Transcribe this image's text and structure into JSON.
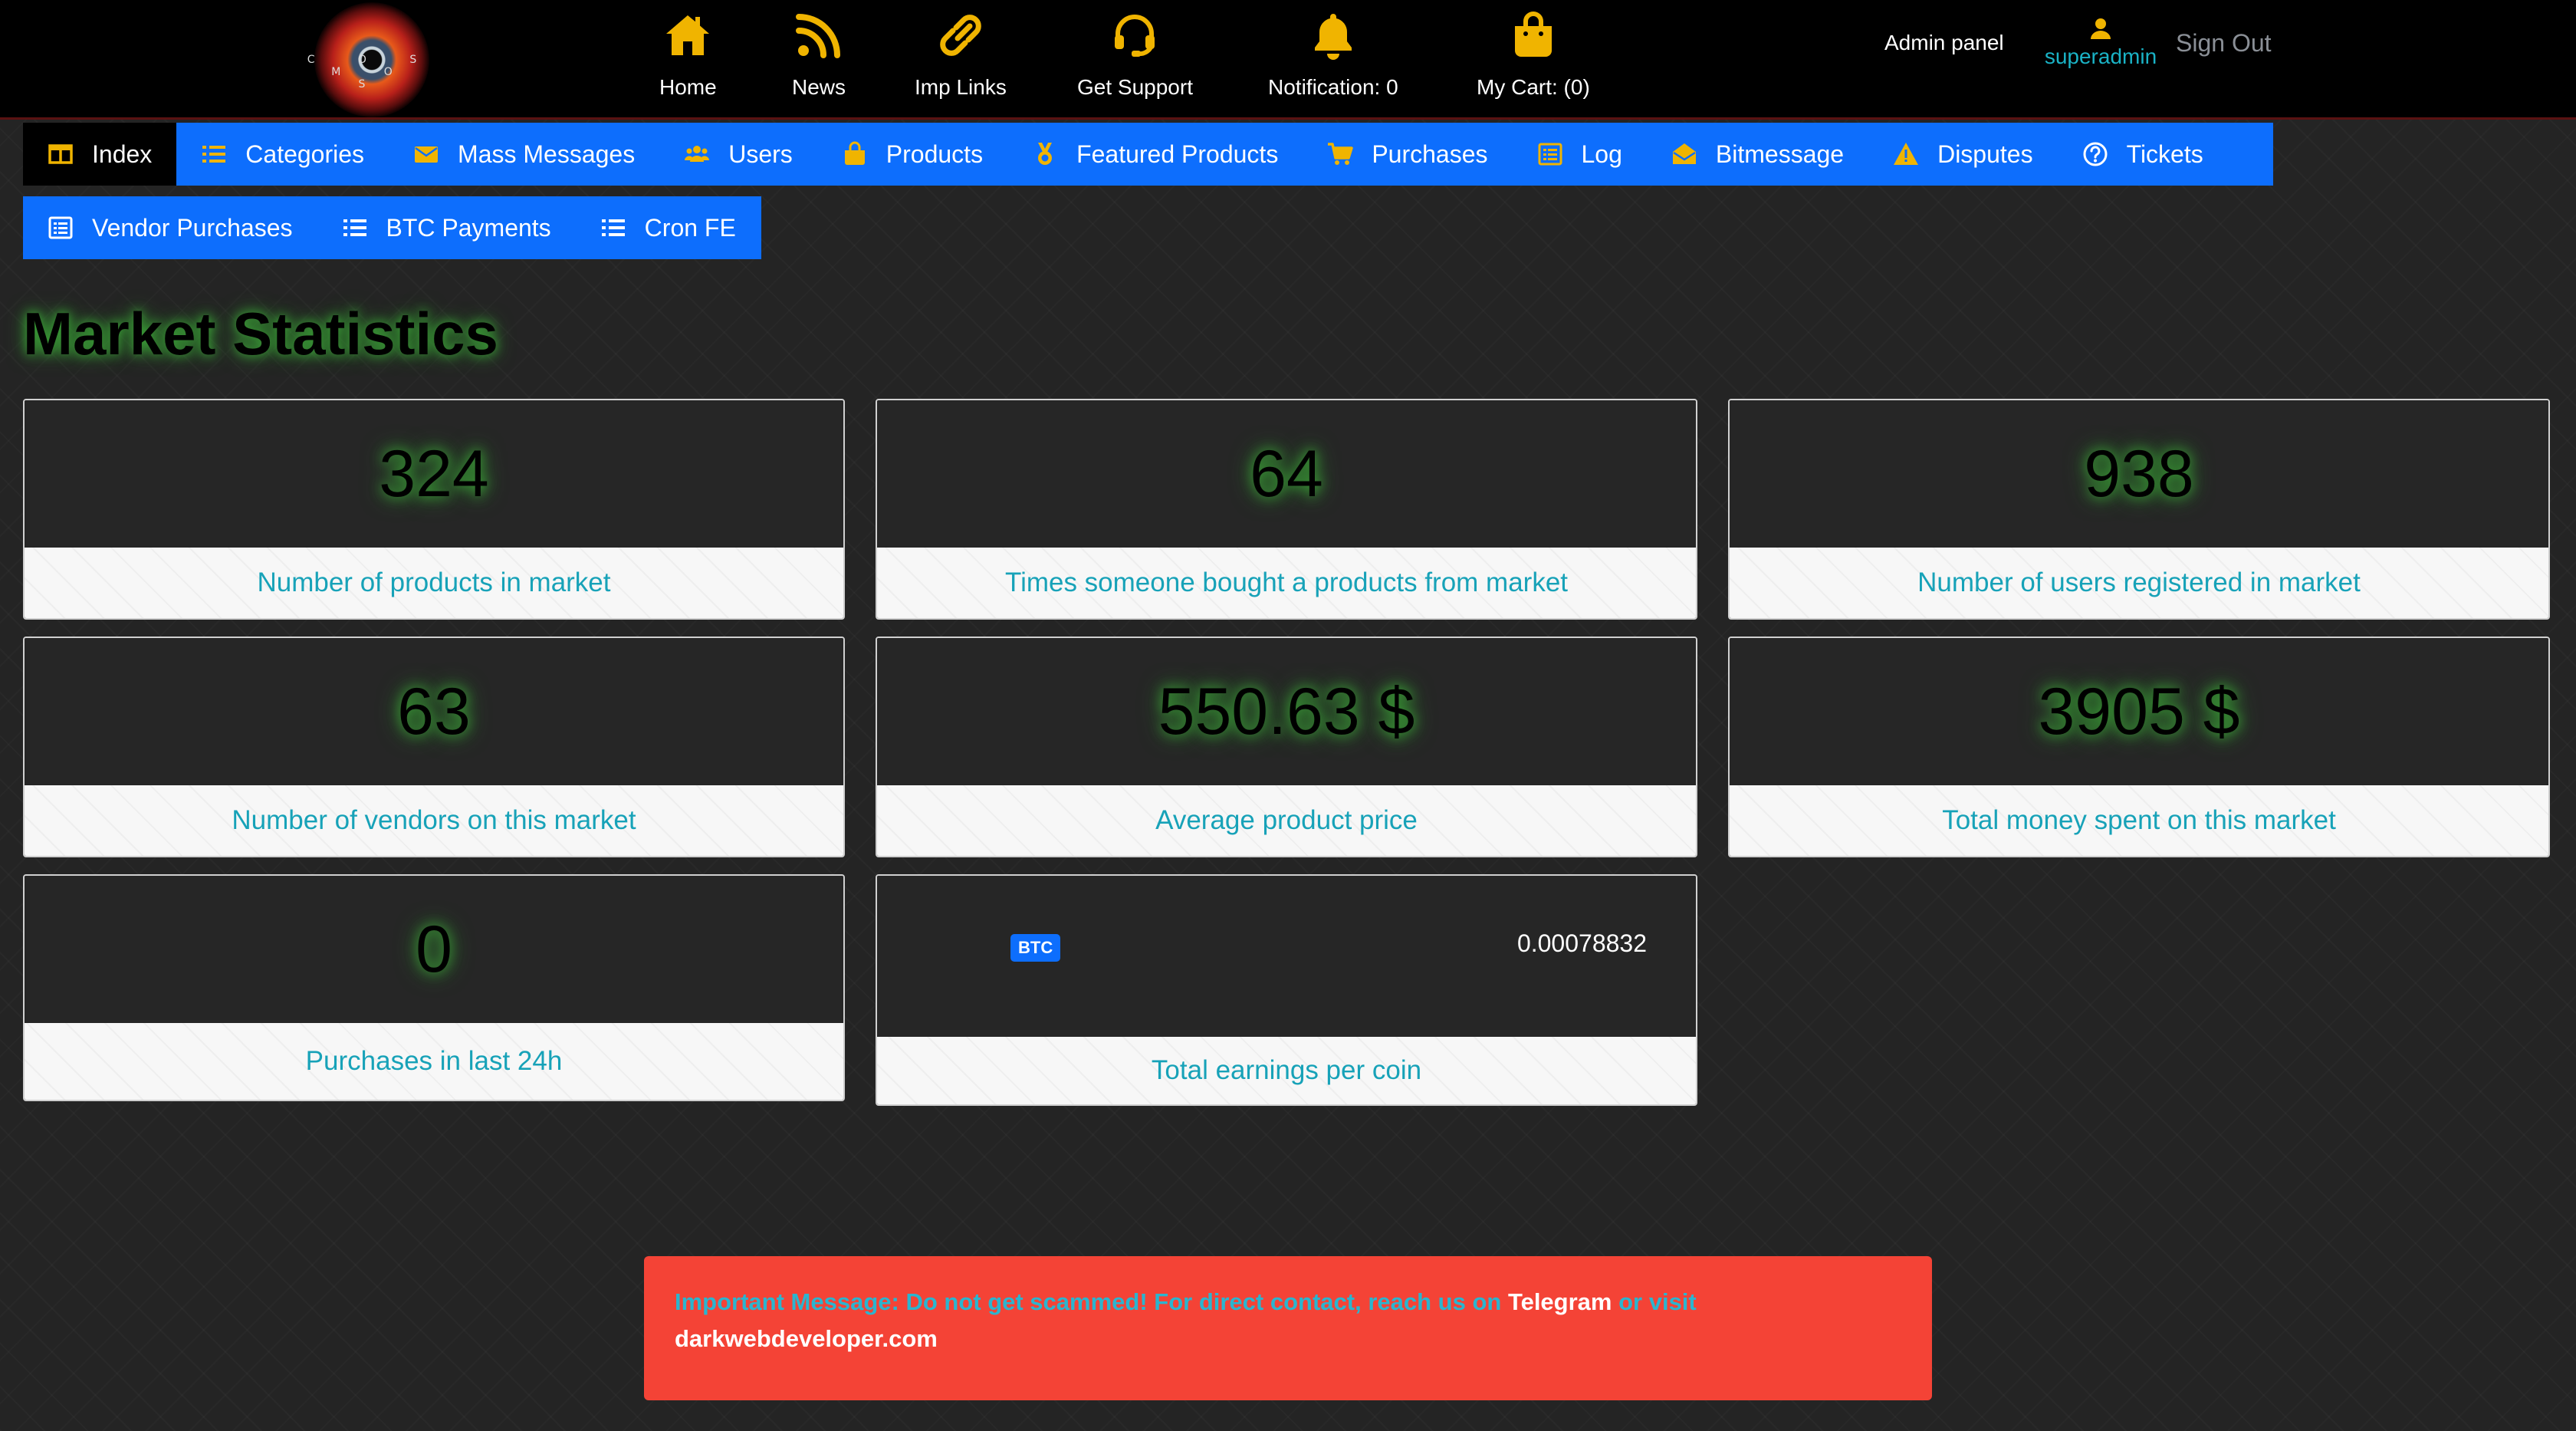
{
  "header": {
    "logo_text": "C O S M O S",
    "nav": [
      {
        "label": "Home",
        "icon": "home-icon"
      },
      {
        "label": "News",
        "icon": "rss-icon"
      },
      {
        "label": "Imp Links",
        "icon": "link-icon"
      },
      {
        "label": "Get Support",
        "icon": "headset-icon"
      },
      {
        "label": "Notification: 0",
        "icon": "bell-icon"
      },
      {
        "label": "My Cart: (0)",
        "icon": "shopping-bag-icon"
      }
    ],
    "admin_panel": "Admin panel",
    "username": "superadmin",
    "sign_out": "Sign Out",
    "accent_color": "#f0b400"
  },
  "tabs_row1": [
    {
      "label": "Index",
      "icon": "columns-icon",
      "active": true
    },
    {
      "label": "Categories",
      "icon": "list-icon"
    },
    {
      "label": "Mass Messages",
      "icon": "envelope-icon"
    },
    {
      "label": "Users",
      "icon": "users-icon"
    },
    {
      "label": "Products",
      "icon": "bag-icon"
    },
    {
      "label": "Featured Products",
      "icon": "medal-icon"
    },
    {
      "label": "Purchases",
      "icon": "cart-icon"
    },
    {
      "label": "Log",
      "icon": "list-alt-icon"
    },
    {
      "label": "Bitmessage",
      "icon": "envelope-open-icon"
    },
    {
      "label": "Disputes",
      "icon": "warning-icon"
    },
    {
      "label": "Tickets",
      "icon": "question-circle-icon"
    }
  ],
  "tabs_row2": [
    {
      "label": "Vendor Purchases",
      "icon": "list-alt-icon"
    },
    {
      "label": "BTC Payments",
      "icon": "list-icon"
    },
    {
      "label": "Cron FE",
      "icon": "list-icon"
    }
  ],
  "page_title": "Market Statistics",
  "stats": [
    {
      "value": "324",
      "label": "Number of products in market"
    },
    {
      "value": "64",
      "label": "Times someone bought a products from market"
    },
    {
      "value": "938",
      "label": "Number of users registered in market"
    },
    {
      "value": "63",
      "label": "Number of vendors on this market"
    },
    {
      "value": "550.63 $",
      "label": "Average product price"
    },
    {
      "value": "3905 $",
      "label": "Total money spent on this market"
    },
    {
      "value": "0",
      "label": "Purchases in last 24h"
    }
  ],
  "earnings": {
    "coin": "BTC",
    "amount": "0.00078832",
    "label": "Total earnings per coin"
  },
  "alert": {
    "text1": "Important Message: Do not get scammed! For direct contact, reach us on ",
    "link1": "Telegram",
    "text2": " or visit",
    "link2": "darkwebdeveloper.com"
  }
}
